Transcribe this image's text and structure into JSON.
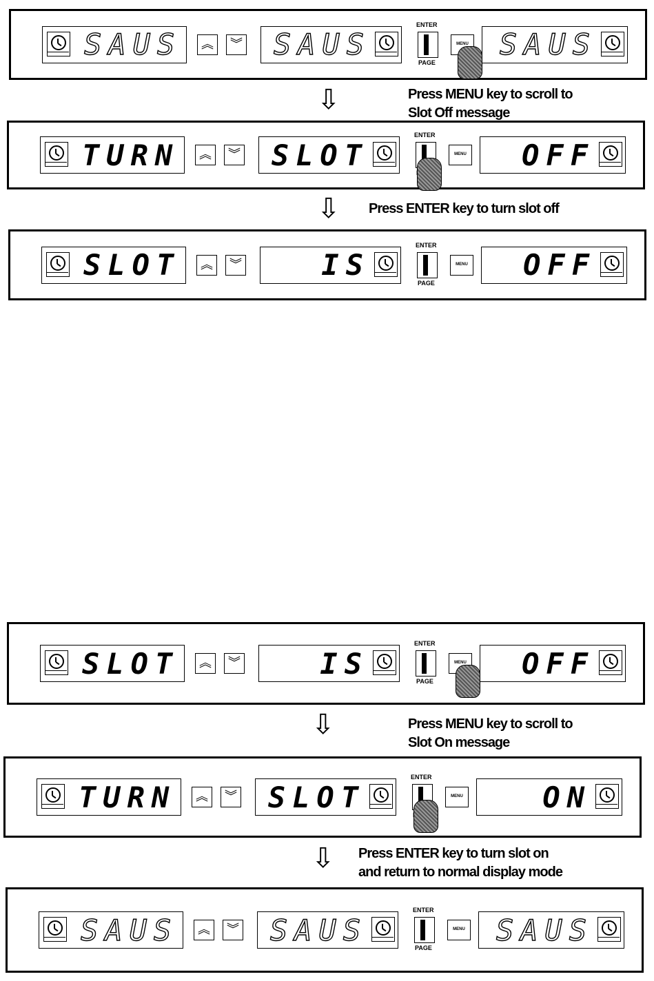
{
  "panels": [
    {
      "left_text": "SAUS",
      "middle_text": "SAUS",
      "right_text": "SAUS",
      "outlined": true,
      "pressed": "menu"
    },
    {
      "left_text": "TURN",
      "middle_text": "SLOT",
      "right_text": "OFF",
      "outlined": false,
      "pressed": "enter"
    },
    {
      "left_text": "SLOT",
      "middle_text": "IS",
      "right_text": "OFF",
      "outlined": false,
      "pressed": null
    },
    {
      "left_text": "SLOT",
      "middle_text": "IS",
      "right_text": "OFF",
      "outlined": false,
      "pressed": "menu"
    },
    {
      "left_text": "TURN",
      "middle_text": "SLOT",
      "right_text": "ON",
      "outlined": false,
      "pressed": "enter"
    },
    {
      "left_text": "SAUS",
      "middle_text": "SAUS",
      "right_text": "SAUS",
      "outlined": true,
      "pressed": null
    }
  ],
  "keys": {
    "enter_label": "ENTER",
    "page_label": "PAGE",
    "menu_label": "MENU",
    "up_symbol": "︽",
    "down_symbol": "︾"
  },
  "captions": [
    "Press MENU key to scroll to\nSlot Off message",
    "Press ENTER key to turn slot off",
    "Press MENU key to scroll to\nSlot On message",
    "Press ENTER key to turn slot on\nand return to normal display mode"
  ],
  "arrow_symbol": "⇩"
}
